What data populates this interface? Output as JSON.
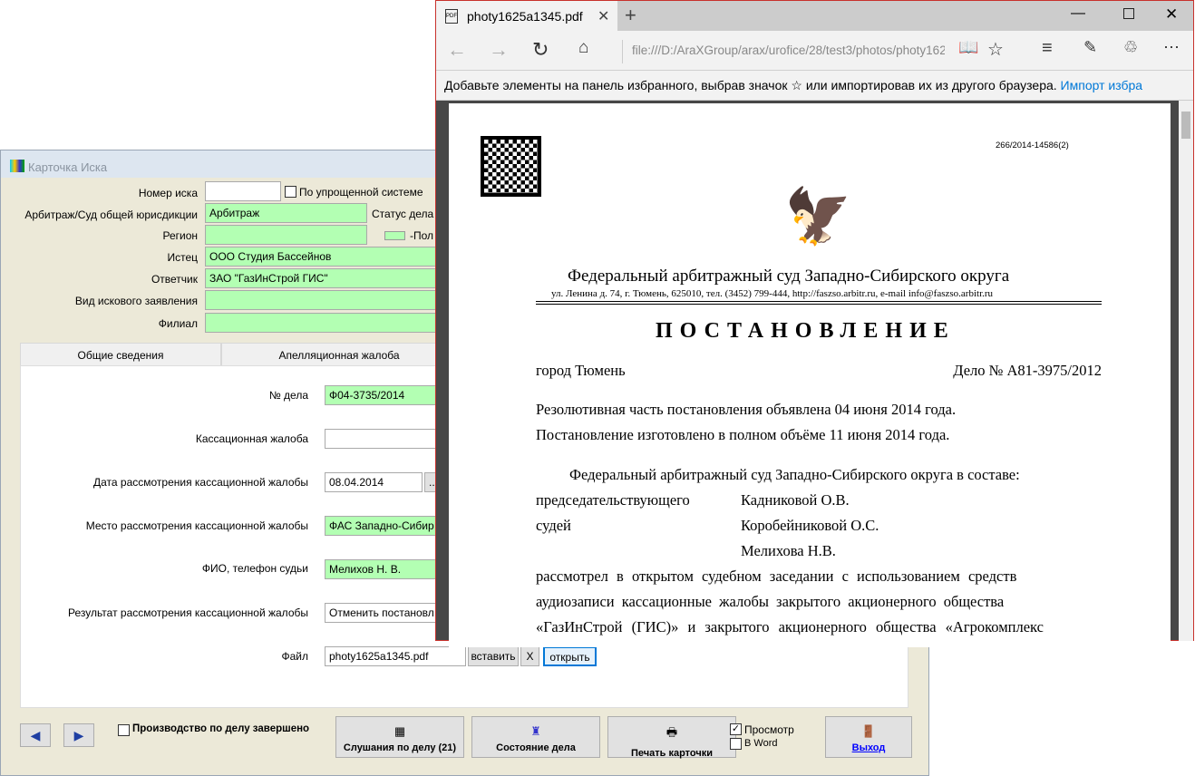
{
  "app": {
    "title": "Карточка Иска",
    "fields": {
      "claim_no_label": "Номер иска",
      "claim_no": "",
      "simplified_label": "По упрощенной системе",
      "court_label": "Арбитраж/Суд общей юрисдикции",
      "court": "Арбитраж",
      "status_label": "Статус дела",
      "region_label": "Регион",
      "region": "",
      "legend_text": "-Пол",
      "plaintiff_label": "Истец",
      "plaintiff": "ООО Студия Бассейнов",
      "defendant_label": "Ответчик",
      "defendant": "ЗАО \"ГазИнСтрой ГИС\"",
      "claim_type_label": "Вид искового заявления",
      "claim_type": "",
      "branch_label": "Филиал",
      "branch": ""
    },
    "tabs": [
      "Общие сведения",
      "Апелляционная жалоба"
    ],
    "panel": {
      "case_no_label": "№ дела",
      "case_no": "Ф04-3735/2014",
      "cassation_label": "Кассационная жалоба",
      "cassation": "",
      "date_label": "Дата рассмотрения кассационной жалобы",
      "date": "08.04.2014",
      "date_btn": "...",
      "place_label": "Место рассмотрения кассационной жалобы",
      "place": "ФАС Западно-Сибир",
      "judge_label": "ФИО, телефон судьи",
      "judge": "Мелихов Н. В.",
      "result_label": "Результат рассмотрения кассационной жалобы",
      "result": "Отменить постановл",
      "file_label": "Файл",
      "file": "photy1625a1345.pdf",
      "insert": "вставить",
      "clear": "X",
      "open": "открыть"
    },
    "bottom": {
      "completed_label": "Производство по делу завершено",
      "hearings": "Слушания по делу (21)",
      "state": "Состояние дела",
      "print": "Печать карточки",
      "preview": "Просмотр",
      "word": "В Word",
      "exit": "Выход"
    }
  },
  "browser": {
    "tab_title": "photy1625a1345.pdf",
    "url": "file:///D:/AraXGroup/arax/urofice/28/test3/photos/photy162",
    "fav_text": "Добавьте элементы на панель избранного, выбрав значок ☆ или импортировав их из другого браузера.",
    "fav_link": "Импорт избра"
  },
  "pdf": {
    "ref": "266/2014-14586(2)",
    "court": "Федеральный арбитражный суд Западно-Сибирского округа",
    "address": "ул. Ленина д. 74, г. Тюмень, 625010, тел. (3452) 799-444, http://faszso.arbitr.ru, e-mail info@faszso.arbitr.ru",
    "heading": "ПОСТАНОВЛЕНИЕ",
    "city": "город Тюмень",
    "case": "Дело № А81-3975/2012",
    "l1": "Резолютивная часть постановления объявлена 04 июня 2014 года.",
    "l2": "Постановление изготовлено в полном объёме 11 июня 2014 года.",
    "l3": "Федеральный арбитражный суд Западно-Сибирского округа в составе:",
    "r1a": "председательствующего",
    "r1b": "Кадниковой О.В.",
    "r2a": "судей",
    "r2b": "Коробейниковой О.С.",
    "r3b": "Мелихова Н.В.",
    "l4": "рассмотрел в открытом судебном заседании с использованием средств",
    "l5": "аудиозаписи кассационные жалобы закрытого акционерного общества",
    "l6": "«ГазИнСтрой (ГИС)» и закрытого акционерного общества «Агрокомплекс"
  }
}
